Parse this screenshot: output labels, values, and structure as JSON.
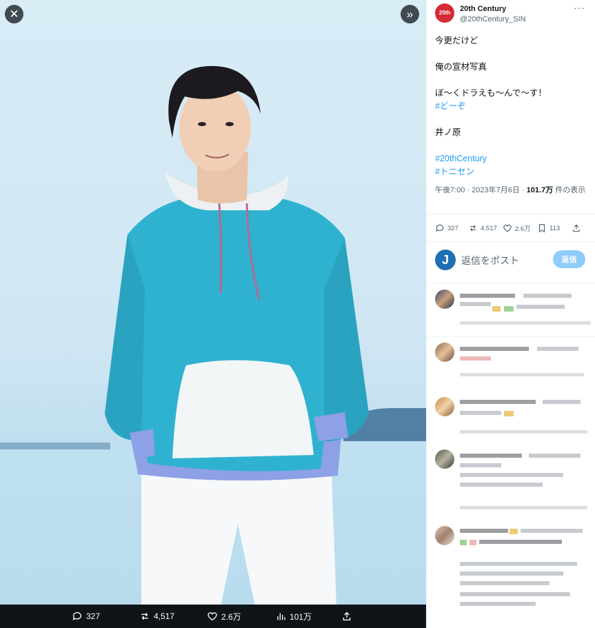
{
  "viewer": {
    "close_icon": "close-icon",
    "expand_icon": "chevron-double-right-icon",
    "stats": {
      "replies": "327",
      "reposts": "4,517",
      "likes": "2.6万",
      "views": "101万"
    }
  },
  "tweet": {
    "author_name": "20th Century",
    "author_handle": "@20thCentury_SIN",
    "avatar_text": "20th",
    "body_lines": [
      "今更だけど",
      "",
      "俺の宣材写真",
      "",
      "ぼ〜くドラえも〜んで〜す！"
    ],
    "hashtag1": "#どーぞ",
    "signature": "井ノ原",
    "hashtag2": "#20thCentury",
    "hashtag3": "#トニセン",
    "meta_time": "午後7:00 · 2023年7月6日 · ",
    "meta_views": "101.7万",
    "meta_suffix": " 件の表示",
    "actions": {
      "replies": "327",
      "reposts": "4,517",
      "likes": "2.6万",
      "bookmarks": "113"
    }
  },
  "reply_box": {
    "avatar_letter": "J",
    "placeholder": "返信をポスト",
    "button_label": "返信"
  },
  "colors": {
    "accent": "#1d9bf0",
    "reply_button": "#8ecdf8",
    "hoodie": "#2fb2cf",
    "viewer_bar": "#0f1419"
  }
}
